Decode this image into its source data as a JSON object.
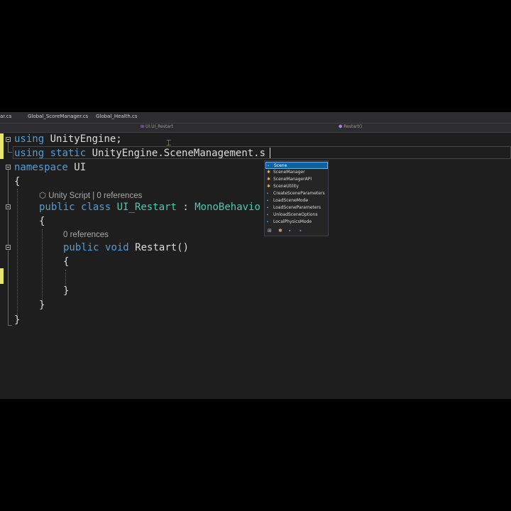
{
  "tabs": [
    "ar.cs",
    "Global_ScoreManager.cs",
    "Global_Health.cs"
  ],
  "navbar": {
    "scope": "UI.UI_Restart",
    "member": "Restart()"
  },
  "code": {
    "line1": {
      "kw": "using",
      "rest": " UnityEngine;"
    },
    "line2": {
      "kw1": "using",
      "kw2": "static",
      "rest": "UnityEngine.SceneManagement.s"
    },
    "line3": {
      "kw": "namespace",
      "rest": " UI"
    },
    "line4": "{",
    "lens1": {
      "icon": "⬡",
      "text": "Unity Script | 0 references"
    },
    "line5": {
      "kw1": "public",
      "kw2": "class",
      "name": "UI_Restart",
      "sep": " : ",
      "base": "MonoBehavio"
    },
    "line6": "{",
    "lens2": "0 references",
    "line7": {
      "kw1": "public",
      "kw2": "void",
      "rest": "Restart()"
    },
    "line8": "{",
    "line9": "}",
    "line10": "}",
    "line11": "}"
  },
  "completion": {
    "items": [
      {
        "label": "Scene",
        "icon": "extension-icon",
        "selected": true
      },
      {
        "label": "SceneManager",
        "icon": "class-icon"
      },
      {
        "label": "SceneManagerAPI",
        "icon": "class-icon"
      },
      {
        "label": "SceneUtility",
        "icon": "class-icon"
      },
      {
        "label": "CreateSceneParameters",
        "icon": "extension-icon"
      },
      {
        "label": "LoadSceneMode",
        "icon": "extension-icon"
      },
      {
        "label": "LoadSceneParameters",
        "icon": "extension-icon"
      },
      {
        "label": "UnloadSceneOptions",
        "icon": "extension-icon"
      },
      {
        "label": "LocalPhysicsMode",
        "icon": "extension-icon"
      }
    ]
  }
}
